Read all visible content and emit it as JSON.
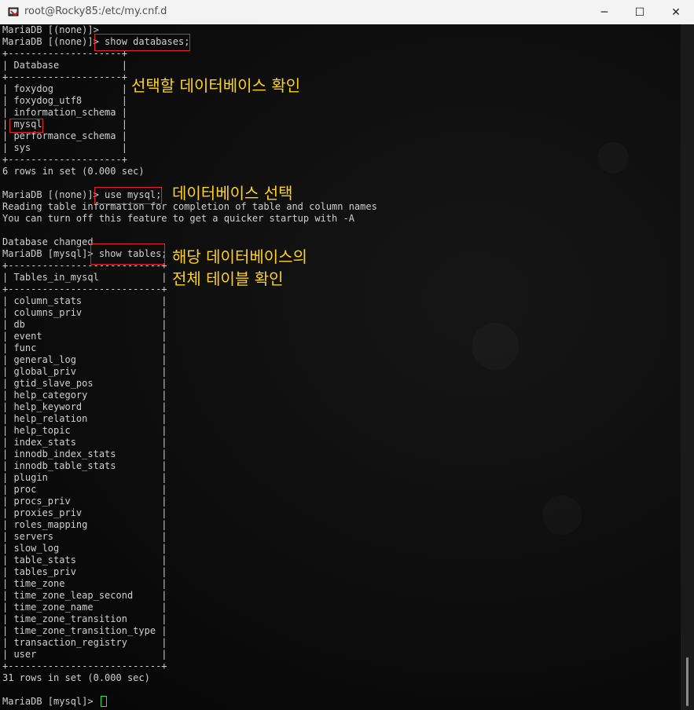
{
  "window": {
    "title": "root@Rocky85:/etc/my.cnf.d",
    "minimize_label": "─",
    "maximize_label": "☐",
    "close_label": "✕"
  },
  "terminal": {
    "lines": [
      "MariaDB [(none)]>",
      "MariaDB [(none)]> show databases;",
      "+--------------------+",
      "| Database           |",
      "+--------------------+",
      "| foxydog            |",
      "| foxydog_utf8       |",
      "| information_schema |",
      "| mysql              |",
      "| performance_schema |",
      "| sys                |",
      "+--------------------+",
      "6 rows in set (0.000 sec)",
      "",
      "MariaDB [(none)]> use mysql;",
      "Reading table information for completion of table and column names",
      "You can turn off this feature to get a quicker startup with -A",
      "",
      "Database changed",
      "MariaDB [mysql]> show tables;",
      "+---------------------------+",
      "| Tables_in_mysql           |",
      "+---------------------------+",
      "| column_stats              |",
      "| columns_priv              |",
      "| db                        |",
      "| event                     |",
      "| func                      |",
      "| general_log               |",
      "| global_priv               |",
      "| gtid_slave_pos            |",
      "| help_category             |",
      "| help_keyword              |",
      "| help_relation             |",
      "| help_topic                |",
      "| index_stats               |",
      "| innodb_index_stats        |",
      "| innodb_table_stats        |",
      "| plugin                    |",
      "| proc                      |",
      "| procs_priv                |",
      "| proxies_priv              |",
      "| roles_mapping             |",
      "| servers                   |",
      "| slow_log                  |",
      "| table_stats               |",
      "| tables_priv               |",
      "| time_zone                 |",
      "| time_zone_leap_second     |",
      "| time_zone_name            |",
      "| time_zone_transition      |",
      "| time_zone_transition_type |",
      "| transaction_registry      |",
      "| user                      |",
      "+---------------------------+",
      "31 rows in set (0.000 sec)",
      "",
      "MariaDB [mysql]> "
    ]
  },
  "annotations": {
    "note1": "선택할 데이터베이스 확인",
    "note2": "데이터베이스 선택",
    "note3_line1": "해당 데이터베이스의",
    "note3_line2": "전체 테이블 확인"
  },
  "colors": {
    "annotation_text": "#ffd21e",
    "highlight_box": "#e8202a",
    "cursor": "#2ee84a"
  }
}
